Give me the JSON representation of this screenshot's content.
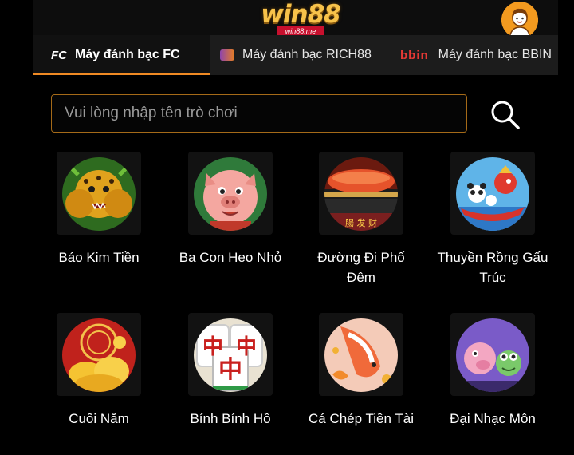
{
  "header": {
    "logo_text": "win88",
    "logo_sub": "win88.me",
    "avatar_icon": "user-avatar-icon"
  },
  "tabs": [
    {
      "icon_text": "FC",
      "label": "Máy đánh bạc FC",
      "active": true
    },
    {
      "icon_text": "",
      "label": "Máy đánh bạc RICH88",
      "active": false
    },
    {
      "icon_text": "bbin",
      "label": "Máy đánh bạc BBIN",
      "active": false
    }
  ],
  "search": {
    "placeholder": "Vui lòng nhập tên trò chơi",
    "value": ""
  },
  "games": [
    {
      "title": "Báo Kim Tiền"
    },
    {
      "title": "Ba Con Heo Nhỏ"
    },
    {
      "title": "Đường Đi Phố Đêm"
    },
    {
      "title": "Thuyền Rồng Gấu Trúc"
    },
    {
      "title": "Cuối Năm"
    },
    {
      "title": "Bính Bính Hồ"
    },
    {
      "title": "Cá Chép Tiền Tài"
    },
    {
      "title": "Đại Nhạc Môn"
    }
  ],
  "colors": {
    "accent": "#f08a24",
    "search_border": "#a56a18",
    "tab_bar": "#1c1c1c"
  }
}
